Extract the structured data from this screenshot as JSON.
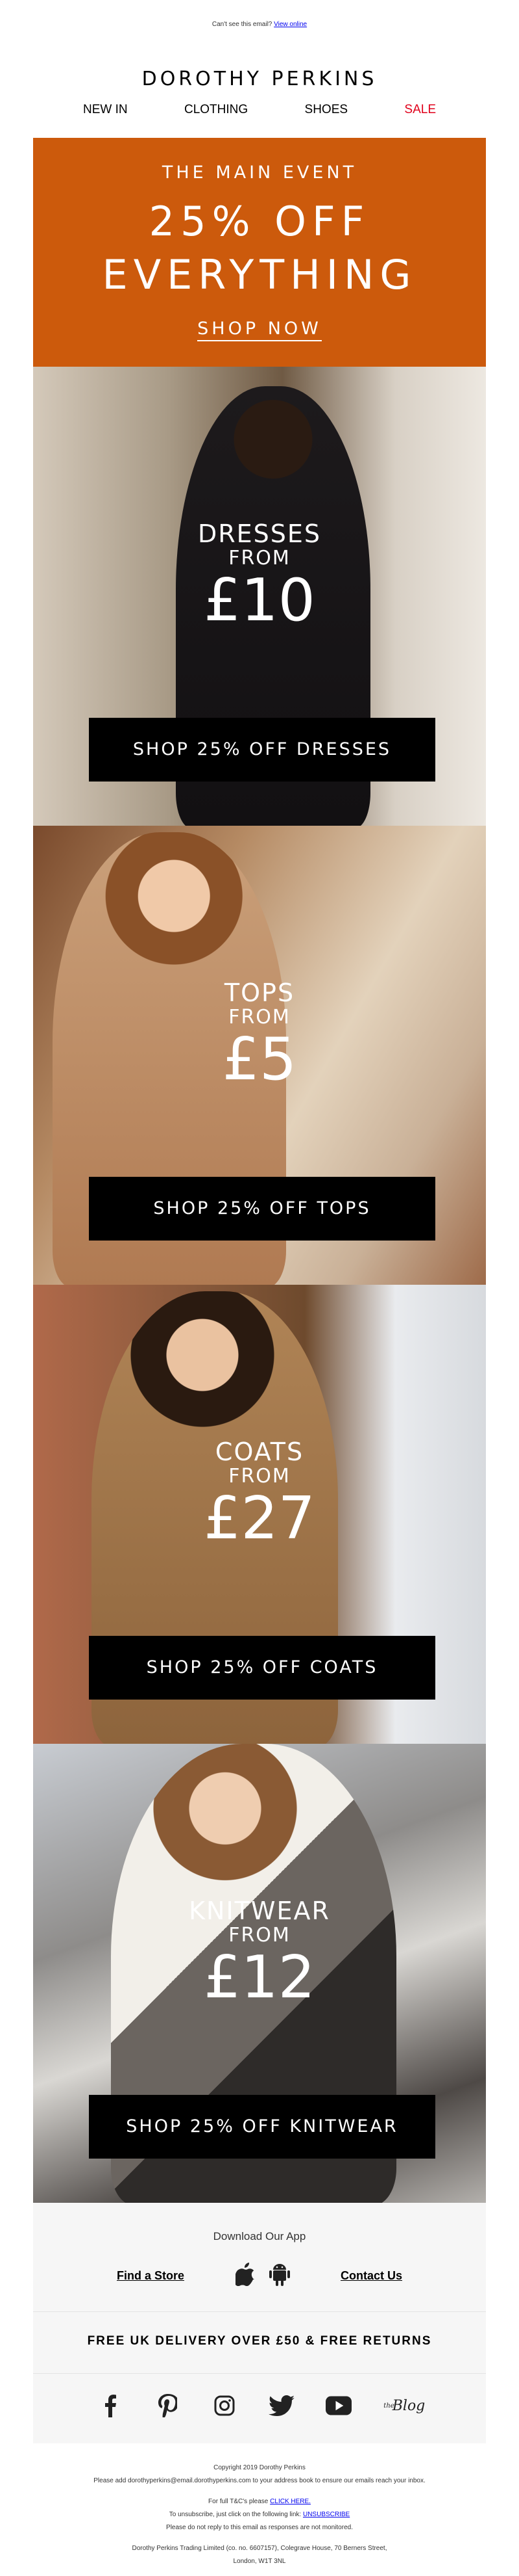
{
  "preheader": {
    "text": "Can't see this email?",
    "link": "View online"
  },
  "brand": {
    "name": "DOROTHY PERKINS"
  },
  "nav": {
    "items": [
      "NEW IN",
      "CLOTHING",
      "SHOES",
      "SALE"
    ]
  },
  "hero": {
    "kicker": "THE MAIN EVENT",
    "line1": "25% OFF",
    "line2": "EVERYTHING",
    "cta": "SHOP NOW",
    "bg_color": "#cc5a0c"
  },
  "panels": [
    {
      "category": "DRESSES",
      "from": "FROM",
      "price": "£10",
      "button": "SHOP 25% OFF DRESSES"
    },
    {
      "category": "TOPS",
      "from": "FROM",
      "price": "£5",
      "button": "SHOP 25% OFF TOPS"
    },
    {
      "category": "COATS",
      "from": "FROM",
      "price": "£27",
      "button": "SHOP 25% OFF COATS"
    },
    {
      "category": "KNITWEAR",
      "from": "FROM",
      "price": "£12",
      "button": "SHOP 25% OFF KNITWEAR"
    }
  ],
  "footer": {
    "app_title": "Download Our App",
    "find_store": "Find a Store",
    "contact": "Contact Us",
    "delivery": "FREE UK DELIVERY OVER £50 & FREE RETURNS",
    "blog": "Blog",
    "social": [
      "facebook-icon",
      "pinterest-icon",
      "instagram-icon",
      "twitter-icon",
      "youtube-icon"
    ],
    "legal": {
      "copyright": "Copyright 2019 Dorothy Perkins",
      "address_book": "Please add dorothyperkins@email.dorothyperkins.com to your address book to ensure our emails reach your inbox.",
      "tcs_prefix": "For full T&C's please",
      "tcs_link": "CLICK HERE.",
      "unsub_prefix": "To unsubscribe, just click on the following link:",
      "unsub_link": "UNSUBSCRIBE",
      "noreply": "Please do not reply to this email as responses are not monitored.",
      "company": "Dorothy Perkins Trading Limited (co. no. 6607157), Colegrave House, 70 Berners Street,",
      "city": "London, W1T 3NL"
    }
  }
}
